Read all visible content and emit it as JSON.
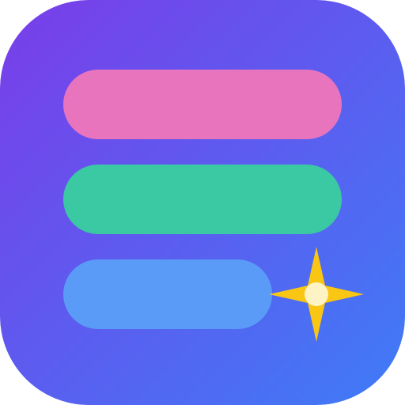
{
  "app_icon": {
    "icon_name": "list-sparkle-icon",
    "colors": {
      "gradient_start": "#7a3de9",
      "gradient_end": "#3e7cf6",
      "bar_top": "#e874bd",
      "bar_middle": "#3ac9a3",
      "bar_bottom": "#5b9bf8",
      "sparkle": "#fac614",
      "sparkle_center": "#fdf3c4"
    },
    "bars": [
      {
        "name": "list-bar-top",
        "color_key": "bar_top"
      },
      {
        "name": "list-bar-middle",
        "color_key": "bar_middle"
      },
      {
        "name": "list-bar-bottom",
        "color_key": "bar_bottom"
      }
    ]
  }
}
